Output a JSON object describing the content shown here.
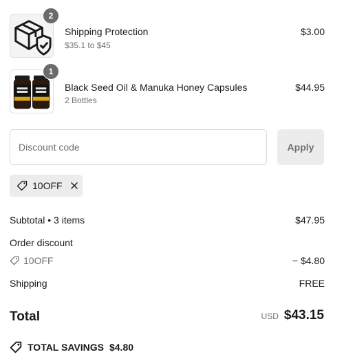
{
  "items": [
    {
      "name": "Shipping Protection",
      "variant": "$35.1 to $45",
      "price": "$3.00",
      "quantity": "2",
      "icon": "shield-box-icon"
    },
    {
      "name": "Black Seed Oil & Manuka Honey Capsules",
      "variant": "2 Bottles",
      "price": "$44.95",
      "quantity": "1",
      "icon": "product-bottles-image"
    }
  ],
  "discount": {
    "placeholder": "Discount code",
    "value": "",
    "apply_label": "Apply",
    "applied_code": "10OFF"
  },
  "summary": {
    "subtotal_label": "Subtotal • 3 items",
    "subtotal_value": "$47.95",
    "order_discount_label": "Order discount",
    "discount_code": "10OFF",
    "discount_value": "− $4.80",
    "shipping_label": "Shipping",
    "shipping_value": "FREE",
    "total_label": "Total",
    "total_currency": "USD",
    "total_value": "$43.15",
    "savings_label": "TOTAL SAVINGS",
    "savings_value": "$4.80"
  },
  "colors": {
    "muted": "#707070",
    "chip": "#ececec",
    "badge": "#6b6b6b",
    "bottle_label": "#d9a514"
  }
}
